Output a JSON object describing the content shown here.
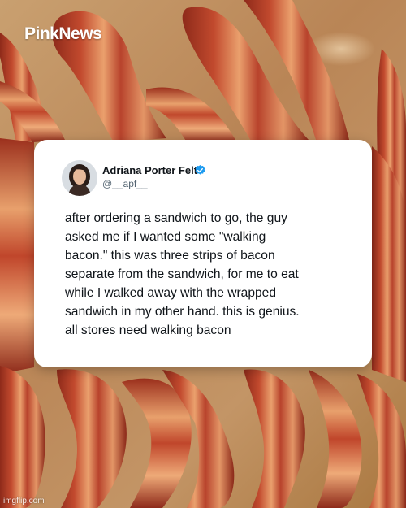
{
  "brand": {
    "logo_text": "PinkNews"
  },
  "tweet": {
    "author_name": "Adriana Porter Felt",
    "handle": "@__apf__",
    "verified": true,
    "lines": [
      "after ordering a sandwich to go, the guy",
      "asked me if I wanted some \"walking",
      "bacon.\" this was three strips of bacon",
      "separate from the sandwich, for me to eat",
      "while I walked away with the wrapped",
      "sandwich in my other hand. this is genius.",
      "all stores need walking bacon"
    ]
  },
  "watermark": "imgflip.com",
  "colors": {
    "verified_badge": "#1d9bf0",
    "bacon_red": "#b8432c",
    "bacon_fat": "#e9a06a",
    "paper": "#c9a070"
  }
}
